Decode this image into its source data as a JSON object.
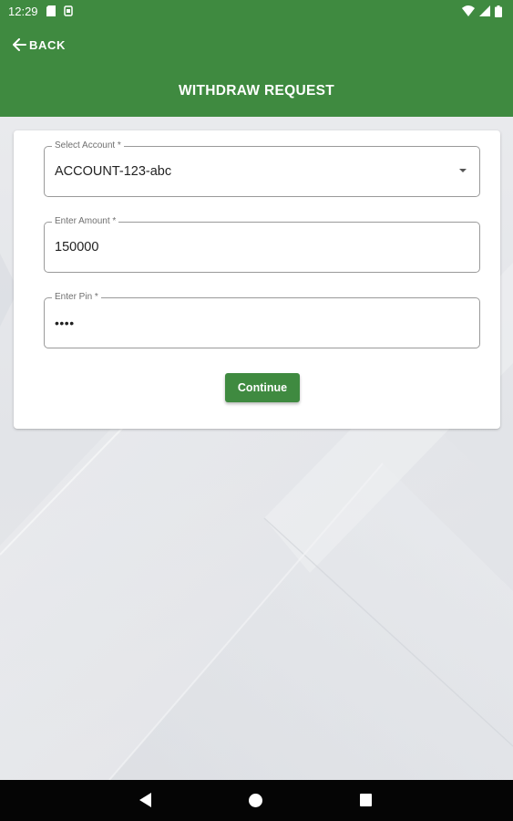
{
  "status_bar": {
    "time": "12:29"
  },
  "header": {
    "back_label": "BACK",
    "title": "WITHDRAW REQUEST"
  },
  "form": {
    "account": {
      "label": "Select Account *",
      "value": "ACCOUNT-123-abc"
    },
    "amount": {
      "label": "Enter Amount *",
      "value": "150000"
    },
    "pin": {
      "label": "Enter Pin *",
      "value": "••••"
    },
    "continue_label": "Continue"
  },
  "colors": {
    "header_bg": "#3f8a40",
    "button_bg": "#3f8a40",
    "background": "#e3e5e9",
    "nav_bar": "#050505"
  },
  "icons": {
    "back": "arrow-left-icon",
    "dropdown": "caret-down-icon",
    "nav_back": "triangle-back-icon",
    "nav_home": "circle-home-icon",
    "nav_recents": "square-recents-icon"
  }
}
